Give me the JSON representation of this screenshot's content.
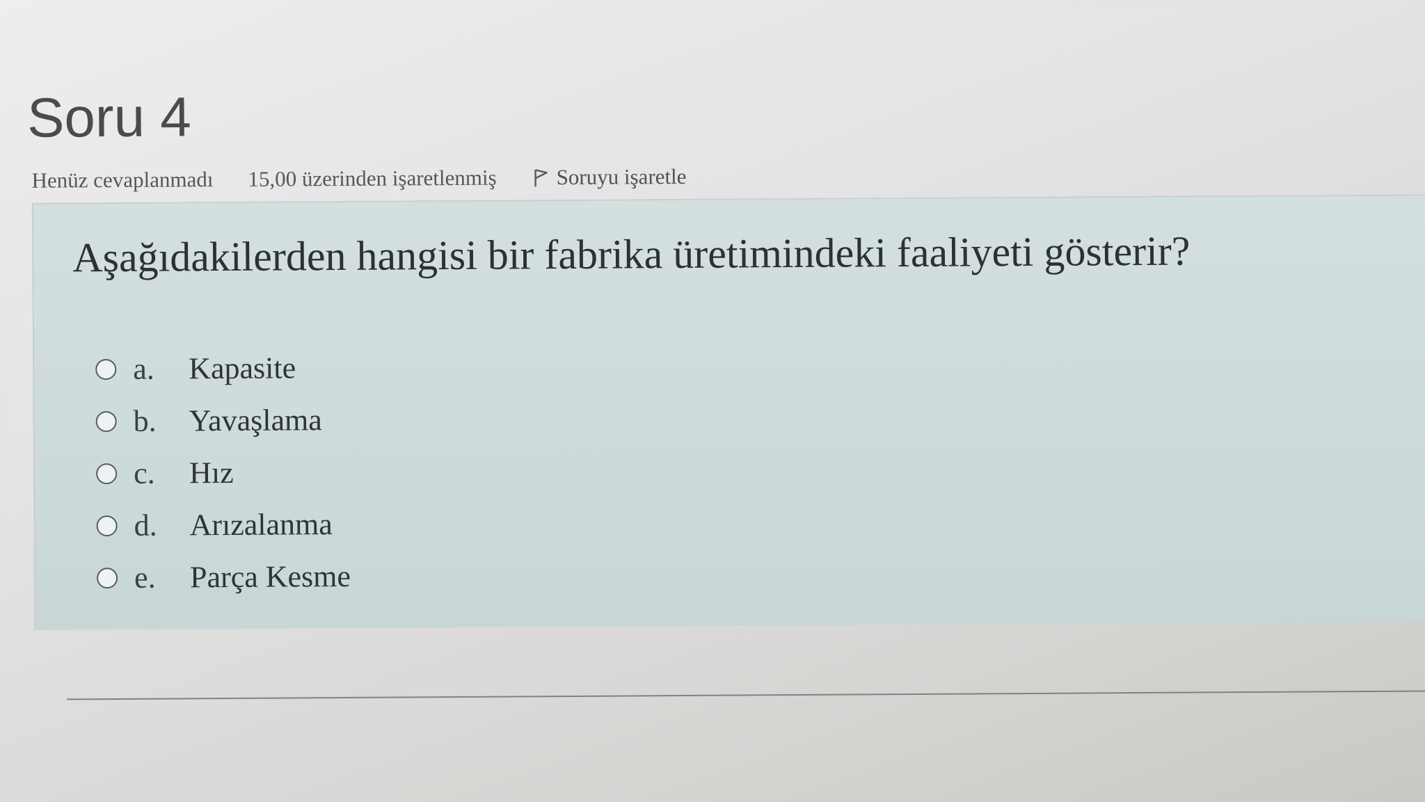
{
  "question": {
    "title": "Soru 4",
    "status": "Henüz cevaplanmadı",
    "grade": "15,00 üzerinden işaretlenmiş",
    "flag_label": "Soruyu işaretle",
    "flag_icon": "flag-icon",
    "text": "Aşağıdakilerden hangisi bir fabrika üretimindeki faaliyeti gösterir?",
    "answers": [
      {
        "letter": "a.",
        "label": "Kapasite"
      },
      {
        "letter": "b.",
        "label": "Yavaşlama"
      },
      {
        "letter": "c.",
        "label": "Hız"
      },
      {
        "letter": "d.",
        "label": "Arızalanma"
      },
      {
        "letter": "e.",
        "label": "Parça Kesme"
      }
    ]
  },
  "colors": {
    "question_box": "#cfdcdc",
    "title_text": "#4b4a4c",
    "body_text": "#2b3134"
  }
}
